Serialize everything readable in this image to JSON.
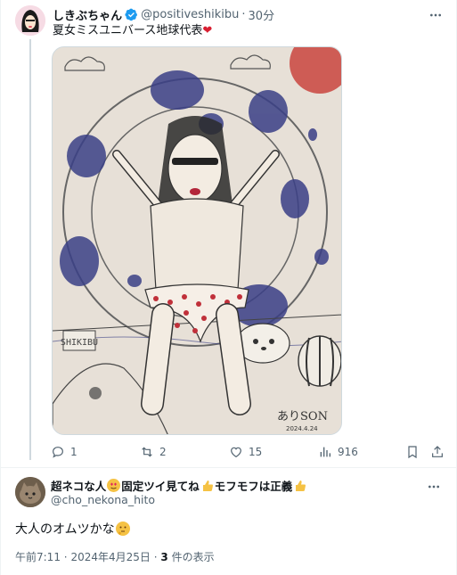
{
  "tweet": {
    "display_name": "しきぶちゃん",
    "handle": "@positiveshikibu",
    "separator": "·",
    "time": "30分",
    "text": "夏女ミスユニバース地球代表",
    "text_emoji": "❤",
    "media": {
      "signature": "ありSON",
      "sign_date": "2024.4.24",
      "sign_text": "SHIKIBU"
    },
    "actions": {
      "replies": "1",
      "retweets": "2",
      "likes": "15",
      "views": "916"
    }
  },
  "reply": {
    "display_name_parts": [
      "超ネコな人",
      "固定ツイ見てね",
      "モフモフは正義"
    ],
    "handle": "@cho_nekona_hito",
    "text": "大人のオムツかな",
    "meta": {
      "time": "午前7:11",
      "separator": "·",
      "date": "2024年4月25日",
      "views_count": "3",
      "views_label": "件の表示"
    }
  },
  "colors": {
    "verified_blue": "#1d9bf0",
    "text_primary": "#0f1419",
    "text_secondary": "#536471",
    "heart_red": "#d81e31"
  },
  "icons": [
    "more-icon",
    "verified-icon",
    "reply-icon",
    "retweet-icon",
    "like-icon",
    "views-icon",
    "bookmark-icon",
    "share-icon"
  ]
}
